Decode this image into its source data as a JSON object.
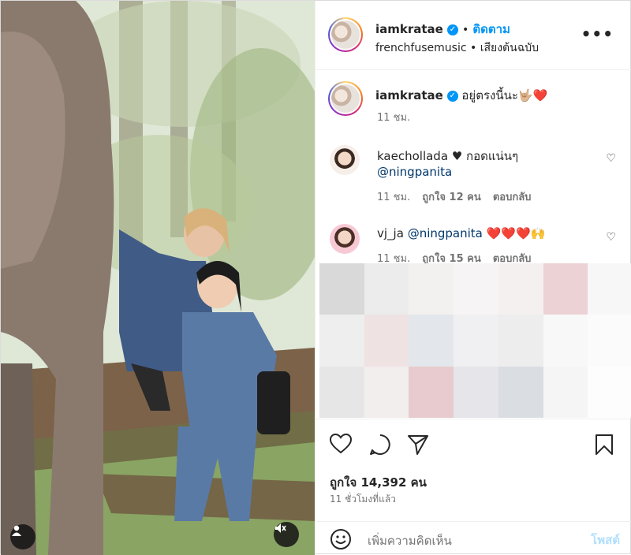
{
  "post": {
    "author": "iamkratae",
    "follow_label": "ติดตาม",
    "bullet": "•",
    "audio": "frenchfusemusic • เสียงต้นฉบับ",
    "more_label": "•••"
  },
  "caption": {
    "author": "iamkratae",
    "text": "อยู่ตรงนี้นะ🤟🏼❤️",
    "time": "11 ชม."
  },
  "comments": [
    {
      "author": "kaechollada",
      "text_suffix": "♥ กอดแน่นๆ",
      "mention": "@ningpanita",
      "time": "11 ชม.",
      "likes": "ถูกใจ 12 คน",
      "reply": "ตอบกลับ"
    },
    {
      "author": "vj_ja",
      "mention": "@ningpanita",
      "text_suffix": "❤️❤️❤️🙌",
      "time": "11 ชม.",
      "likes": "ถูกใจ 15 คน",
      "reply": "ตอบกลับ"
    }
  ],
  "stats": {
    "likes": "ถูกใจ 14,392 คน",
    "time_ago": "11 ชั่วโมงที่แล้ว"
  },
  "composer": {
    "placeholder": "เพิ่มความคิดเห็น",
    "post_label": "โพสต์"
  },
  "icons": {
    "verified": "✓",
    "heart": "♡"
  },
  "colors": {
    "accent": "#0095f6",
    "mention": "#00376b",
    "muted": "#737373"
  }
}
